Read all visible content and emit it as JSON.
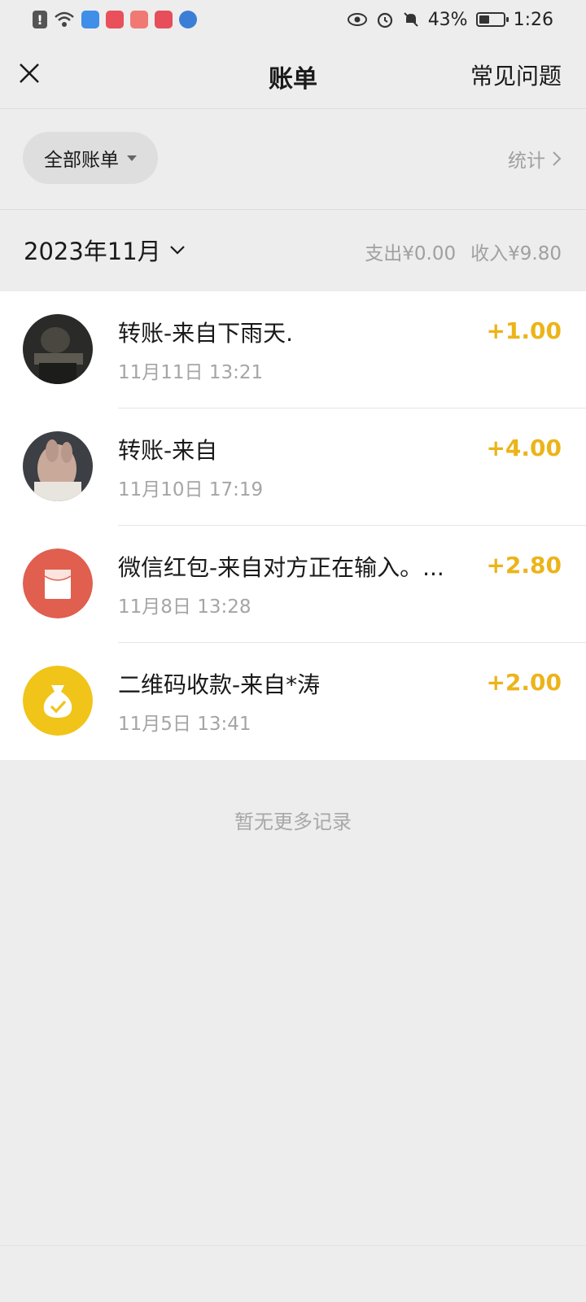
{
  "status_bar": {
    "battery_text": "43%",
    "battery_level": 0.43,
    "time": "1:26",
    "icons": [
      "alert-icon",
      "wifi-icon",
      "app-icon",
      "app-icon",
      "app-icon",
      "app-icon",
      "browser-icon",
      "eye-icon",
      "alarm-icon",
      "mute-icon",
      "battery-icon"
    ]
  },
  "nav": {
    "title": "账单",
    "faq_label": "常见问题"
  },
  "filter": {
    "label": "全部账单",
    "stats_label": "统计"
  },
  "month": {
    "label": "2023年11月",
    "expense": "支出¥0.00",
    "income": "收入¥9.80"
  },
  "transactions": [
    {
      "title": "转账-来自下雨天.",
      "time": "11月11日 13:21",
      "amount": "+1.00",
      "avatar": "photo"
    },
    {
      "title": "转账-来自",
      "time": "11月10日 17:19",
      "amount": "+4.00",
      "avatar": "photo"
    },
    {
      "title": "微信红包-来自对方正在输入。...",
      "time": "11月8日 13:28",
      "amount": "+2.80",
      "avatar": "red-packet-icon"
    },
    {
      "title": "二维码收款-来自*涛",
      "time": "11月5日 13:41",
      "amount": "+2.00",
      "avatar": "money-bag-icon"
    }
  ],
  "footer": {
    "no_more": "暂无更多记录"
  },
  "colors": {
    "accent_amount": "#ecb419",
    "red_packet": "#e05f4f",
    "money_bag": "#f0c419",
    "background": "#ededed"
  }
}
